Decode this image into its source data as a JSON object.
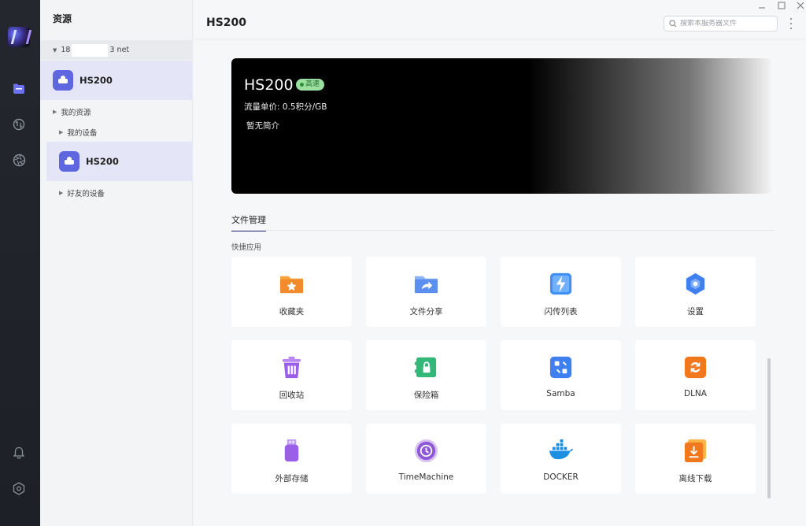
{
  "sidebar": {
    "title": "资源",
    "account": {
      "prefix": "18",
      "suffix": "3 net"
    },
    "selected_device": "HS200",
    "my_resources_label": "我的资源",
    "my_devices_label": "我的设备",
    "device_under_my": "HS200",
    "friends_devices_label": "好友的设备"
  },
  "header": {
    "title": "HS200",
    "search_placeholder": "搜索本服务器文件"
  },
  "banner": {
    "name": "HS200",
    "badge": "高速",
    "price": "流量单价: 0.5积分/GB",
    "description": "暂无简介"
  },
  "tabs": [
    {
      "label": "文件管理",
      "active": true
    }
  ],
  "quick_apps": {
    "label": "快捷应用",
    "items": [
      {
        "label": "收藏夹",
        "icon": "favorites-folder-icon",
        "color": "#f28a2e"
      },
      {
        "label": "文件分享",
        "icon": "share-folder-icon",
        "color": "#5b8ff0"
      },
      {
        "label": "闪传列表",
        "icon": "flash-transfer-icon",
        "color": "#3f8ef2"
      },
      {
        "label": "设置",
        "icon": "settings-gear-icon",
        "color": "#3f7ff0"
      },
      {
        "label": "回收站",
        "icon": "trash-icon",
        "color": "#9a5fe8"
      },
      {
        "label": "保险箱",
        "icon": "safe-box-icon",
        "color": "#34b87a"
      },
      {
        "label": "Samba",
        "icon": "samba-icon",
        "color": "#3f7ff0"
      },
      {
        "label": "DLNA",
        "icon": "dlna-icon",
        "color": "#f2781e"
      },
      {
        "label": "外部存储",
        "icon": "usb-storage-icon",
        "color": "#9a5fe8"
      },
      {
        "label": "TimeMachine",
        "icon": "time-machine-icon",
        "color": "#8e58d6"
      },
      {
        "label": "DOCKER",
        "icon": "docker-icon",
        "color": "#1d8fe0"
      },
      {
        "label": "离线下载",
        "icon": "offline-download-icon",
        "color": "#f2781e"
      }
    ]
  }
}
